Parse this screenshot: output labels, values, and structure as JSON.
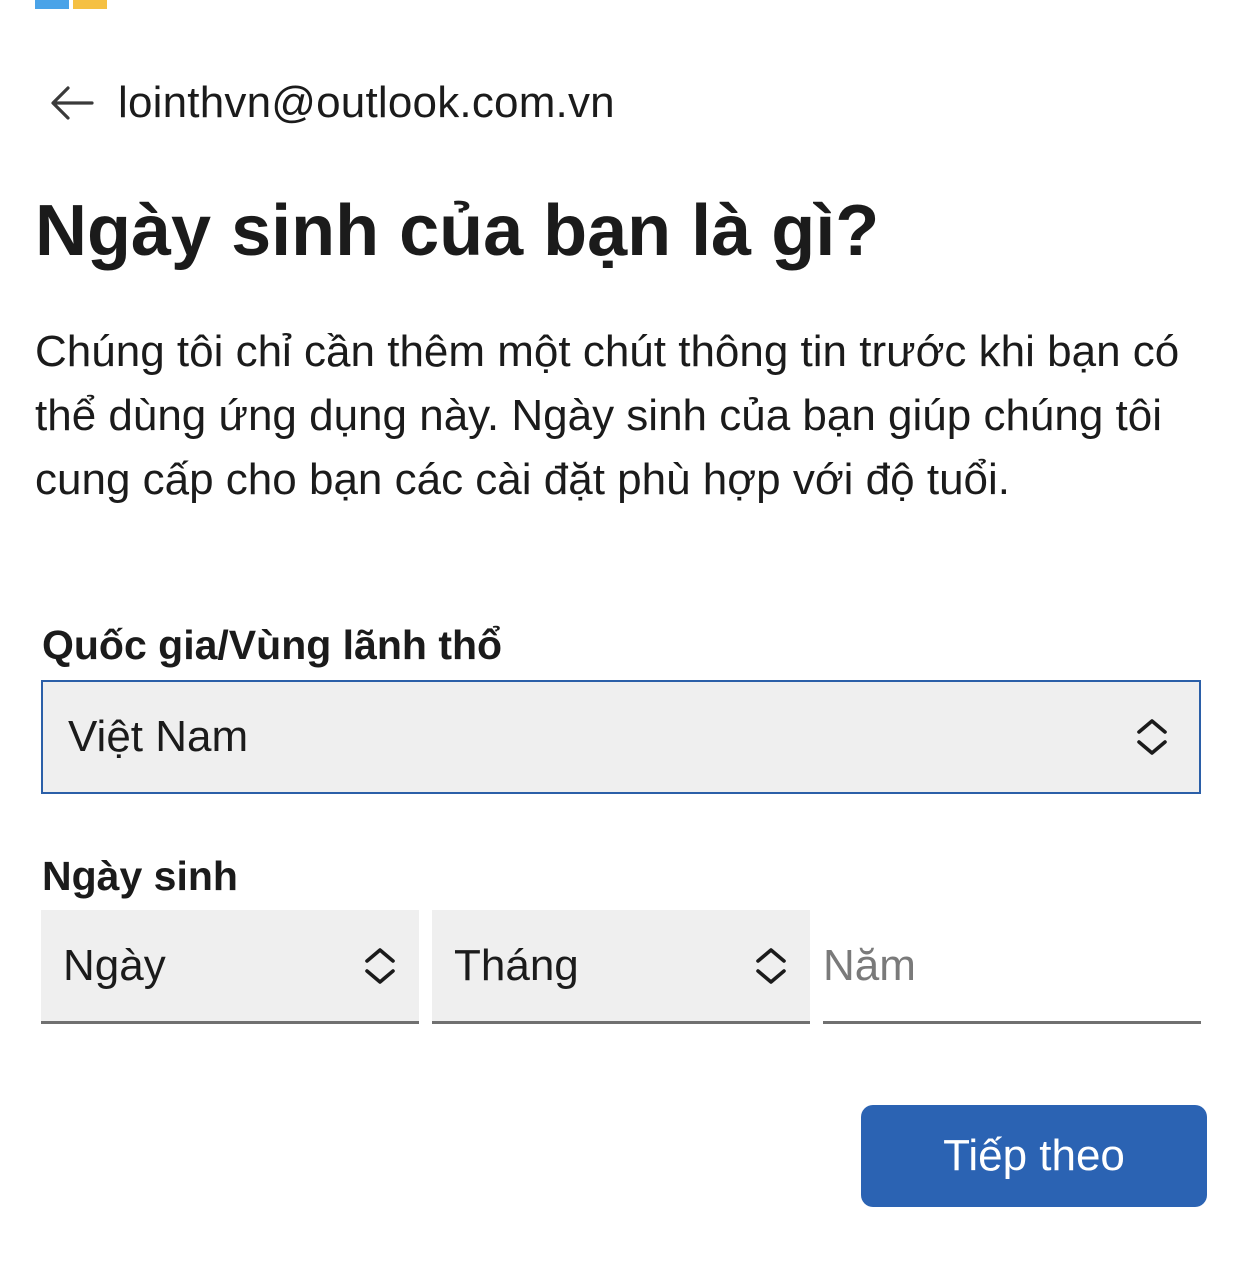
{
  "brand": {
    "colors": [
      "#4aa3e8",
      "#f5c042"
    ]
  },
  "identity": {
    "back_icon": "arrow-left-icon",
    "email": "lointhvn@outlook.com.vn"
  },
  "page": {
    "title": "Ngày sinh của bạn là gì?",
    "description": "Chúng tôi chỉ cần thêm một chút thông tin trước khi bạn có thể dùng ứng dụng này. Ngày sinh của bạn giúp chúng tôi cung cấp cho bạn các cài đặt phù hợp với độ tuổi."
  },
  "form": {
    "country": {
      "label": "Quốc gia/Vùng lãnh thổ",
      "value": "Việt Nam",
      "icon": "chevron-up-down-icon"
    },
    "birthdate": {
      "label": "Ngày sinh",
      "day_placeholder": "Ngày",
      "month_placeholder": "Tháng",
      "year_placeholder": "Năm",
      "year_value": ""
    }
  },
  "actions": {
    "next_label": "Tiếp theo"
  },
  "colors": {
    "accent": "#2b63b3",
    "focus_border": "#2b5fa8",
    "field_background": "#efefef",
    "underline": "#707070",
    "text": "#1b1b1b"
  }
}
